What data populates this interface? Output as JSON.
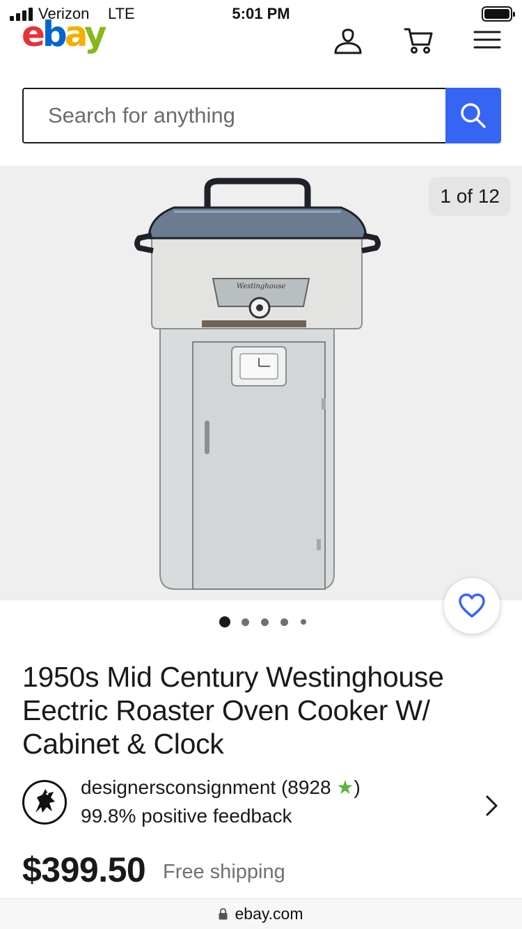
{
  "status_bar": {
    "carrier": "Verizon",
    "network": "LTE",
    "time": "5:01 PM"
  },
  "header": {
    "logo_text": "ebay",
    "brand_colors": [
      "#e53238",
      "#0064d2",
      "#f5af02",
      "#86b817"
    ],
    "icons": [
      "user-icon",
      "cart-icon",
      "menu-icon"
    ]
  },
  "search": {
    "placeholder": "Search for anything",
    "value": "",
    "button_icon": "search-icon",
    "accent_color": "#3665f3"
  },
  "gallery": {
    "counter": "1 of 12",
    "current_image": 1,
    "total_images": 12,
    "dots_visible": 5,
    "active_dot": 1
  },
  "listing": {
    "title": "1950s Mid Century Westinghouse Eectric Roaster Oven Cooker W/ Cabinet & Clock",
    "brand_on_product": "Westinghouse",
    "price": "$399.50",
    "shipping": "Free shipping"
  },
  "seller": {
    "name": "designersconsignment (8928",
    "star": "★",
    "name_suffix": ")",
    "feedback": "99.8% positive feedback"
  },
  "browser": {
    "url": "ebay.com"
  }
}
